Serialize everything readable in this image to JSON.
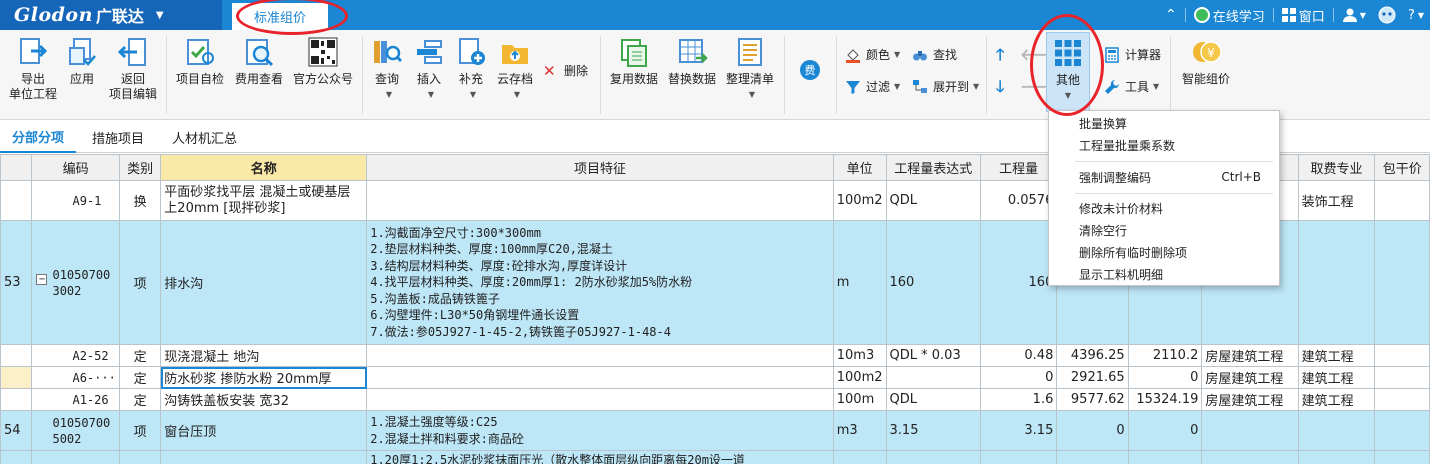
{
  "titlebar": {
    "brand": "Glodon",
    "brand_cn": "广联达",
    "doc_tab": "标准组价",
    "online_learning": "在线学习",
    "window": "窗口",
    "help": "?"
  },
  "ribbon": {
    "export": [
      "导出",
      "单位工程"
    ],
    "apply": "应用",
    "back": [
      "返回",
      "项目编辑"
    ],
    "self_check": "项目自检",
    "fee_view": "费用查看",
    "official_account": "官方公众号",
    "query": "查询",
    "insert": "插入",
    "supplement": "补充",
    "cloud_save": "云存档",
    "delete": "删除",
    "reuse_data": "复用数据",
    "replace_data": "替换数据",
    "organize_list": "整理清单",
    "fee_badge": "费",
    "color": "颜色",
    "find": "查找",
    "filter": "过滤",
    "expand_to": "展开到",
    "other": "其他",
    "calculator": "计算器",
    "tools": "工具",
    "smart_pricing": "智能组价"
  },
  "subtabs": [
    "分部分项",
    "措施项目",
    "人材机汇总"
  ],
  "grid": {
    "headers": [
      "编码",
      "类别",
      "名称",
      "项目特征",
      "单位",
      "工程量表达式",
      "工程量",
      "",
      "",
      "",
      "取费专业",
      "包干价"
    ],
    "rows": [
      {
        "no": "",
        "code": "A9-1",
        "type": "换",
        "name": "平面砂浆找平层 混凝土或硬基层上20mm [现拌砂浆]",
        "feature": "",
        "unit": "100m2",
        "expr": "QDL",
        "qty": "0.0576",
        "p1": "",
        "p2": "",
        "c1": "",
        "c2": "装饰工程"
      },
      {
        "no": "53",
        "code": "010507003002",
        "type": "项",
        "name": "排水沟",
        "feature": "1.沟截面净空尺寸:300*300mm\n2.垫层材料种类、厚度:100mm厚C20,混凝土\n3.结构层材料种类、厚度:砼排水沟,厚度详设计\n4.找平层材料种类、厚度:20mm厚1: 2防水砂浆加5%防水粉\n5.沟盖板:成品铸铁篦子\n6.沟壁埋件:L30*50角钢埋件通长设置\n7.做法:参05J927-1-45-2,铸铁篦子05J927-1-48-4",
        "unit": "m",
        "expr": "160",
        "qty": "160",
        "p1": "",
        "p2": "",
        "c1": "",
        "c2": ""
      },
      {
        "no": "",
        "code": "A2-52",
        "type": "定",
        "name": "现浇混凝土 地沟",
        "feature": "",
        "unit": "10m3",
        "expr": "QDL * 0.03",
        "qty": "0.48",
        "p1": "4396.25",
        "p2": "2110.2",
        "c1": "房屋建筑工程",
        "c2": "建筑工程"
      },
      {
        "no": "",
        "code": "A6-···",
        "type": "定",
        "name": "防水砂浆 掺防水粉 20mm厚",
        "feature": "",
        "unit": "100m2",
        "expr": "",
        "qty": "0",
        "p1": "2921.65",
        "p2": "0",
        "c1": "房屋建筑工程",
        "c2": "建筑工程"
      },
      {
        "no": "",
        "code": "A1-26",
        "type": "定",
        "name": "沟铸铁盖板安装 宽32",
        "feature": "",
        "unit": "100m",
        "expr": "QDL",
        "qty": "1.6",
        "p1": "9577.62",
        "p2": "15324.19",
        "c1": "房屋建筑工程",
        "c2": "建筑工程"
      },
      {
        "no": "54",
        "code": "010507005002",
        "type": "项",
        "name": "窗台压顶",
        "feature": "1.混凝土强度等级:C25\n2.混凝土拌和料要求:商品砼",
        "unit": "m3",
        "expr": "3.15",
        "qty": "3.15",
        "p1": "0",
        "p2": "0",
        "c1": "",
        "c2": ""
      },
      {
        "no": "",
        "code": "",
        "type": "",
        "name": "",
        "feature": "1.20厚1:2.5水泥砂浆抹面压光（散水整体面层纵向距离每20m设一道",
        "unit": "",
        "expr": "",
        "qty": "",
        "p1": "",
        "p2": "",
        "c1": "",
        "c2": ""
      }
    ]
  },
  "menu": {
    "items": [
      "批量换算",
      "工程量批量乘系数",
      "强制调整编码",
      "修改未计价材料",
      "清除空行",
      "删除所有临时删除项",
      "显示工料机明细"
    ],
    "shortcut": "Ctrl+B"
  },
  "colors": {
    "titlebar": "#1b86d4",
    "accent": "#1b86d4",
    "annotation": "#e8242a",
    "row_highlight": "#bde6f6"
  }
}
